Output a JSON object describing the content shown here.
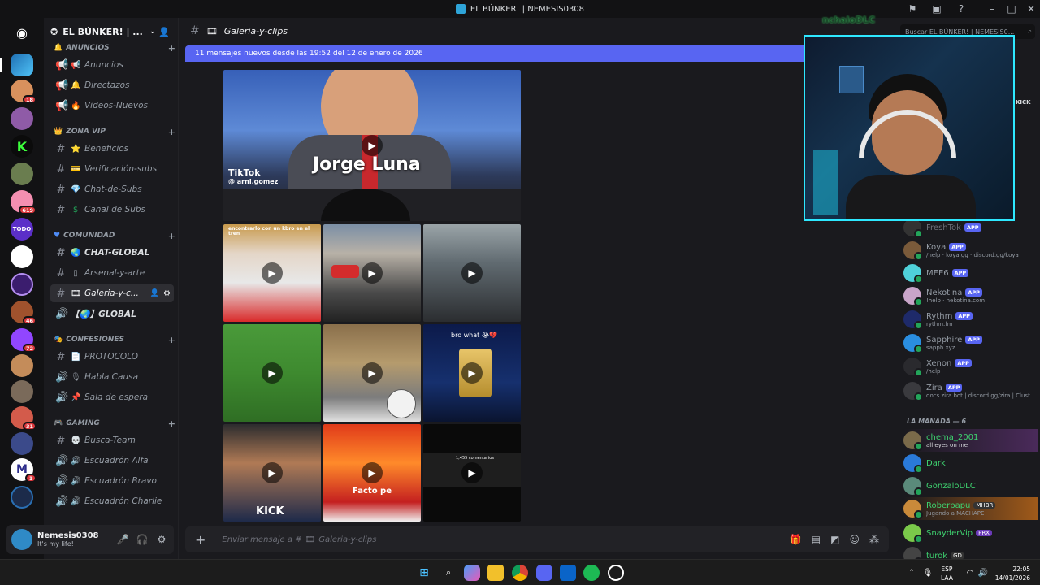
{
  "window": {
    "title": "EL BÚNKER! | NEMESIS0308"
  },
  "guild": {
    "name": "EL BÚNKER! | ..."
  },
  "categories": [
    {
      "label": "ANUNCIOS"
    },
    {
      "label": "ZONA VIP"
    },
    {
      "label": "COMUNIDAD"
    },
    {
      "label": "CONFESIONES"
    },
    {
      "label": "GAMING"
    }
  ],
  "channels": [
    {
      "label": "Anuncios"
    },
    {
      "label": "Directazos"
    },
    {
      "label": "Videos-Nuevos"
    },
    {
      "label": "Beneficios"
    },
    {
      "label": "Verificación-subs"
    },
    {
      "label": "Chat-de-Subs"
    },
    {
      "label": "Canal de Subs"
    },
    {
      "label": "CHAT-GLOBAL"
    },
    {
      "label": "Arsenal-y-arte"
    },
    {
      "label": "Galeria-y-c..."
    },
    {
      "label": "【🌏】GLOBAL"
    },
    {
      "label": "PROTOCOLO"
    },
    {
      "label": "Habla Causa"
    },
    {
      "label": "Sala de espera"
    },
    {
      "label": "Busca-Team"
    },
    {
      "label": "Escuadrón Alfa"
    },
    {
      "label": "Escuadrón Bravo"
    },
    {
      "label": "Escuadrón Charlie"
    }
  ],
  "server_badges": [
    "18",
    "619",
    "46",
    "72",
    "31",
    "1"
  ],
  "user": {
    "name": "Nemesis0308",
    "status": "It's my life!"
  },
  "channel_header": {
    "name": "Galeria-y-clips"
  },
  "new_messages": {
    "text": "11 mensajes nuevos desde las 19:52 del 12 de enero de 2026"
  },
  "gallery": {
    "top_caption": "Jorge Luna",
    "top_tiktok": "TikTok",
    "top_handle": "@ arni.gomez",
    "tile1_caption": "encontrarlo con un kbro en el tren",
    "tile6_caption": "bro what 😭💔",
    "tile8_caption": "Facto pe",
    "tile7_caption": "KICK",
    "tile9_caption": "1,455 comentarios"
  },
  "composer": {
    "placeholder": "Enviar mensaje a #",
    "channel": "Galeria-y-clips"
  },
  "search": {
    "placeholder": "Buscar EL BÚNKER! | NEMESIS0..."
  },
  "members": {
    "apps": [
      {
        "name": "FreshTok",
        "badge": "APP",
        "sub": ""
      },
      {
        "name": "Koya",
        "badge": "APP",
        "sub": "/help · koya.gg · discord.gg/koya"
      },
      {
        "name": "MEE6",
        "badge": "APP",
        "sub": ""
      },
      {
        "name": "Nekotina",
        "badge": "APP",
        "sub": "!help · nekotina.com"
      },
      {
        "name": "Rythm",
        "badge": "APP",
        "sub": "rythm.fm"
      },
      {
        "name": "Sapphire",
        "badge": "APP",
        "sub": "sapph.xyz"
      },
      {
        "name": "Xenon",
        "badge": "APP",
        "sub": "/help"
      },
      {
        "name": "Zira",
        "badge": "APP",
        "sub": "docs.zira.bot | discord.gg/zira | Clust"
      }
    ],
    "section": "LA MANADA — 6",
    "people": [
      {
        "name": "chema_2001",
        "sub": "all eyes on me",
        "tag": ""
      },
      {
        "name": "Dark",
        "sub": "",
        "tag": ""
      },
      {
        "name": "GonzaloDLC",
        "sub": "",
        "tag": ""
      },
      {
        "name": "Roberpapu",
        "sub": "Jugando a MACHAPE",
        "tag": "MHBR"
      },
      {
        "name": "SnayderVip",
        "sub": "",
        "tag": "PRX"
      },
      {
        "name": "turok",
        "sub": "",
        "tag": "GD"
      }
    ]
  },
  "overlay": {
    "name": "nchaloDLC",
    "kick": "KICK"
  },
  "taskbar": {
    "lang1": "ESP",
    "lang2": "LAA",
    "time": "22:05",
    "date": "14/01/2026"
  }
}
